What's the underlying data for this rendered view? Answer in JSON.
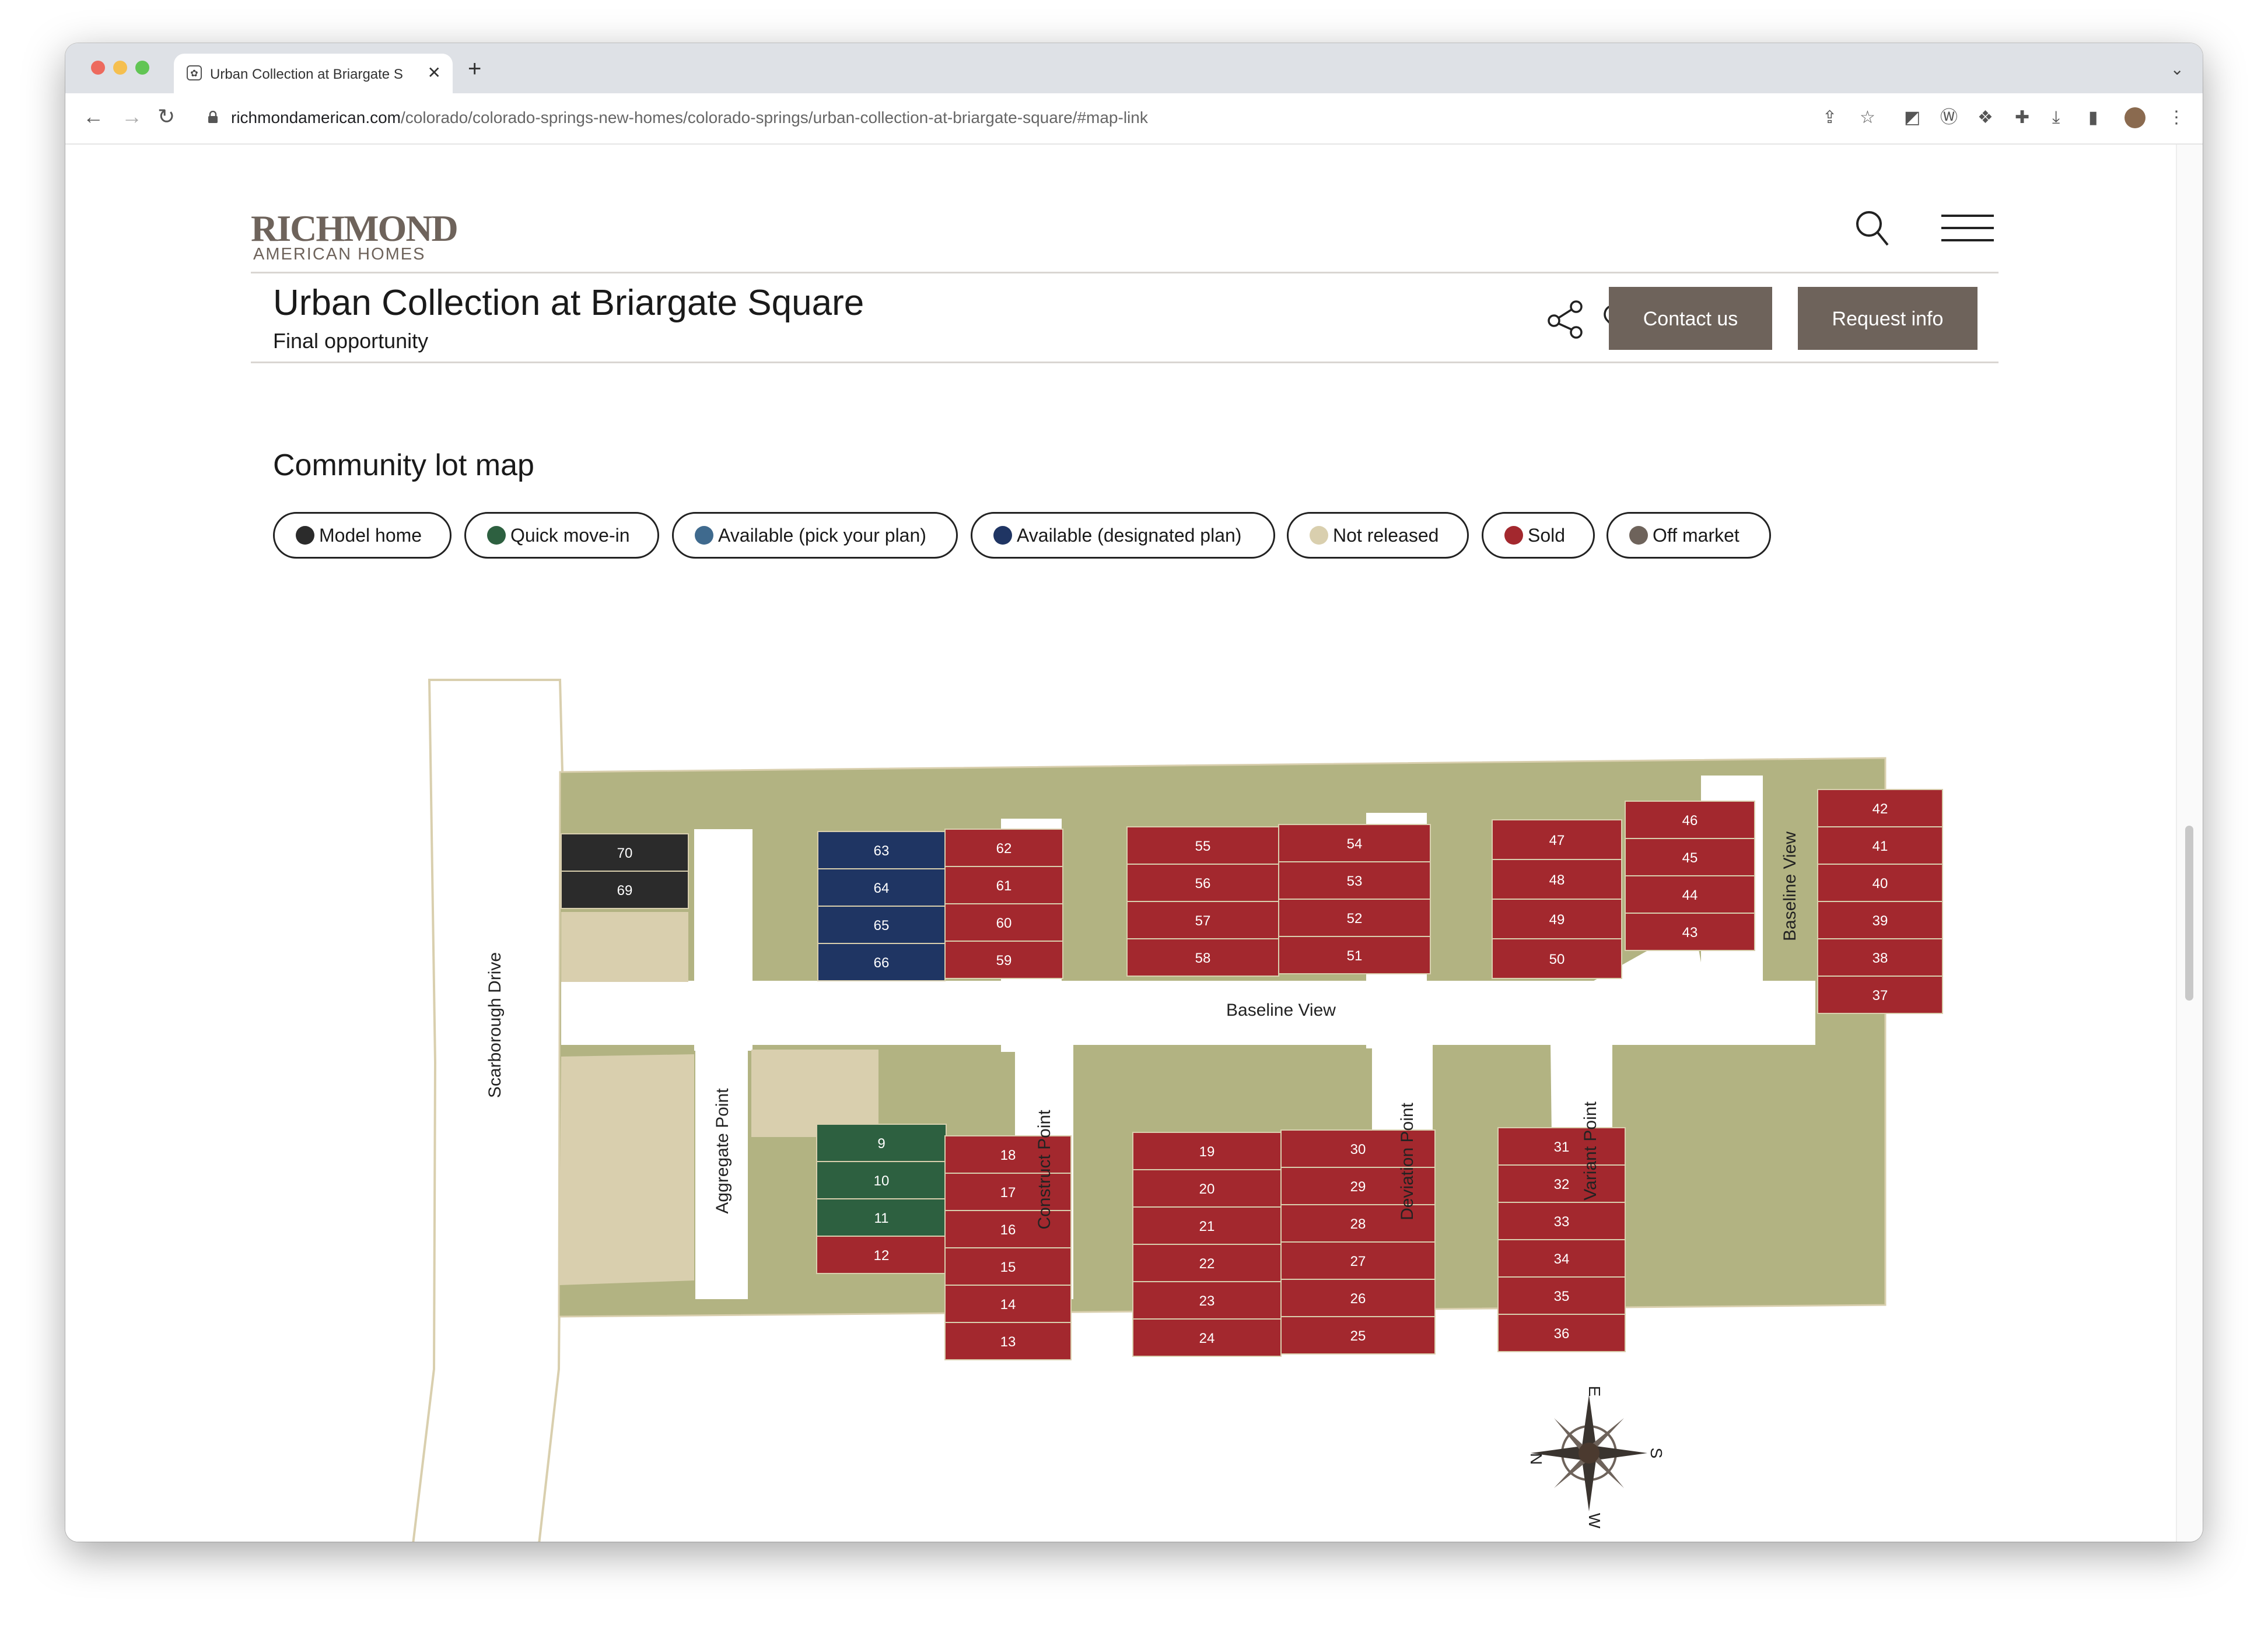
{
  "browser": {
    "tab_title": "Urban Collection at Briargate Square",
    "url_domain": "richmondamerican.com",
    "url_path": "/colorado/colorado-springs-new-homes/colorado-springs/urban-collection-at-briargate-square/#map-link"
  },
  "header": {
    "logo_line1": "RICHMOND",
    "logo_line2": "AMERICAN HOMES"
  },
  "community": {
    "title": "Urban Collection at Briargate Square",
    "status": "Final opportunity",
    "contact_label": "Contact us",
    "request_label": "Request info"
  },
  "lot_map": {
    "heading": "Community lot map",
    "legend": [
      {
        "label": "Model home",
        "color": "#2b2b2b"
      },
      {
        "label": "Quick move-in",
        "color": "#2d6040"
      },
      {
        "label": "Available (pick your plan)",
        "color": "#3f6a8e"
      },
      {
        "label": "Available (designated plan)",
        "color": "#1f3563"
      },
      {
        "label": "Not released",
        "color": "#d9cfae"
      },
      {
        "label": "Sold",
        "color": "#a3282e"
      },
      {
        "label": "Off market",
        "color": "#6e635b"
      }
    ],
    "streets": [
      "Scarborough Drive",
      "Aggregate Point",
      "Construct Point",
      "Baseline View",
      "Deviation Point",
      "Variant Point",
      "Baseline View"
    ],
    "lots": [
      {
        "n": "70",
        "status": "model"
      },
      {
        "n": "69",
        "status": "model"
      },
      {
        "n": "63",
        "status": "designated"
      },
      {
        "n": "64",
        "status": "designated"
      },
      {
        "n": "65",
        "status": "designated"
      },
      {
        "n": "66",
        "status": "designated"
      },
      {
        "n": "62",
        "status": "sold"
      },
      {
        "n": "61",
        "status": "sold"
      },
      {
        "n": "60",
        "status": "sold"
      },
      {
        "n": "59",
        "status": "sold"
      },
      {
        "n": "55",
        "status": "sold"
      },
      {
        "n": "56",
        "status": "sold"
      },
      {
        "n": "57",
        "status": "sold"
      },
      {
        "n": "58",
        "status": "sold"
      },
      {
        "n": "54",
        "status": "sold"
      },
      {
        "n": "53",
        "status": "sold"
      },
      {
        "n": "52",
        "status": "sold"
      },
      {
        "n": "51",
        "status": "sold"
      },
      {
        "n": "47",
        "status": "sold"
      },
      {
        "n": "48",
        "status": "sold"
      },
      {
        "n": "49",
        "status": "sold"
      },
      {
        "n": "50",
        "status": "sold"
      },
      {
        "n": "46",
        "status": "sold"
      },
      {
        "n": "45",
        "status": "sold"
      },
      {
        "n": "44",
        "status": "sold"
      },
      {
        "n": "43",
        "status": "sold"
      },
      {
        "n": "42",
        "status": "sold"
      },
      {
        "n": "41",
        "status": "sold"
      },
      {
        "n": "40",
        "status": "sold"
      },
      {
        "n": "39",
        "status": "sold"
      },
      {
        "n": "38",
        "status": "sold"
      },
      {
        "n": "37",
        "status": "sold"
      },
      {
        "n": "9",
        "status": "quick"
      },
      {
        "n": "10",
        "status": "quick"
      },
      {
        "n": "11",
        "status": "quick"
      },
      {
        "n": "12",
        "status": "sold"
      },
      {
        "n": "18",
        "status": "sold"
      },
      {
        "n": "17",
        "status": "sold"
      },
      {
        "n": "16",
        "status": "sold"
      },
      {
        "n": "15",
        "status": "sold"
      },
      {
        "n": "14",
        "status": "sold"
      },
      {
        "n": "13",
        "status": "sold"
      },
      {
        "n": "19",
        "status": "sold"
      },
      {
        "n": "20",
        "status": "sold"
      },
      {
        "n": "21",
        "status": "sold"
      },
      {
        "n": "22",
        "status": "sold"
      },
      {
        "n": "23",
        "status": "sold"
      },
      {
        "n": "24",
        "status": "sold"
      },
      {
        "n": "30",
        "status": "sold"
      },
      {
        "n": "29",
        "status": "sold"
      },
      {
        "n": "28",
        "status": "sold"
      },
      {
        "n": "27",
        "status": "sold"
      },
      {
        "n": "26",
        "status": "sold"
      },
      {
        "n": "25",
        "status": "sold"
      },
      {
        "n": "31",
        "status": "sold"
      },
      {
        "n": "32",
        "status": "sold"
      },
      {
        "n": "33",
        "status": "sold"
      },
      {
        "n": "34",
        "status": "sold"
      },
      {
        "n": "35",
        "status": "sold"
      },
      {
        "n": "36",
        "status": "sold"
      }
    ],
    "compass": {
      "n": "N",
      "e": "E",
      "s": "S",
      "w": "W"
    }
  }
}
